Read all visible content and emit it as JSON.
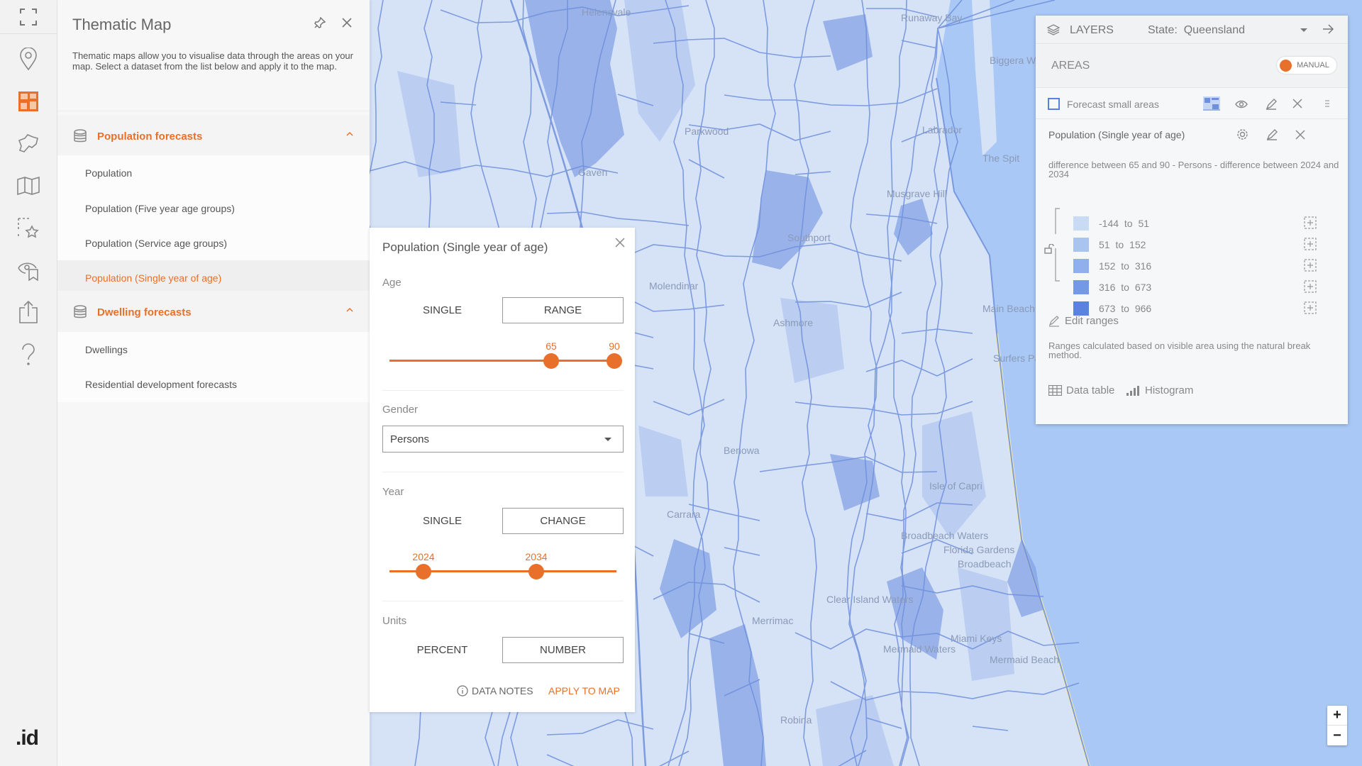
{
  "colors": {
    "accent": "#e8702a",
    "sea": "#a9c8f5",
    "land": "#d6e2f6",
    "boundary": "#6e8fdc"
  },
  "rail": {
    "icons": [
      "fullscreen-icon",
      "location-pin-icon",
      "thematic-map-icon",
      "area-shape-icon",
      "basemap-icon",
      "favourite-area-icon",
      "view-bookmark-icon",
      "share-export-icon",
      "help-icon"
    ],
    "logo": ".id"
  },
  "panel": {
    "title": "Thematic Map",
    "description": "Thematic maps allow you to visualise data through the areas on your map. Select a dataset from the list below and apply it to the map.",
    "sections": [
      {
        "label": "Population forecasts",
        "items": [
          "Population",
          "Population (Five year age groups)",
          "Population (Service age groups)",
          "Population (Single year of age)"
        ],
        "active": "Population (Single year of age)"
      },
      {
        "label": "Dwelling forecasts",
        "items": [
          "Dwellings",
          "Residential development forecasts"
        ]
      }
    ]
  },
  "popup": {
    "title": "Population (Single year of age)",
    "age": {
      "label": "Age",
      "options": [
        "SINGLE",
        "RANGE"
      ],
      "selected": "RANGE",
      "min": 65,
      "max": 90,
      "range_min": 0,
      "range_max": 90
    },
    "gender": {
      "label": "Gender",
      "value": "Persons"
    },
    "year": {
      "label": "Year",
      "options": [
        "SINGLE",
        "CHANGE"
      ],
      "selected": "CHANGE",
      "from": "2024",
      "to": "2034",
      "values": [
        "2024",
        "2034"
      ]
    },
    "units": {
      "label": "Units",
      "options": [
        "PERCENT",
        "NUMBER"
      ],
      "selected": "NUMBER"
    },
    "data_notes": "DATA NOTES",
    "apply": "APPLY TO MAP"
  },
  "layers": {
    "title": "LAYERS",
    "state_label": "State:",
    "state_value": "Queensland",
    "areas_label": "AREAS",
    "toggle_label": "MANUAL",
    "layer_name": "Forecast small areas",
    "dataset": "Population (Single year of age)",
    "description": "difference between 65 and 90 - Persons - difference between 2024 and 2034",
    "legend": [
      {
        "label": "-144 to 51",
        "color": "#c9daf5"
      },
      {
        "label": "51 to 152",
        "color": "#aac4f0"
      },
      {
        "label": "152 to 316",
        "color": "#8fb0ec"
      },
      {
        "label": "316 to 673",
        "color": "#7399e6"
      },
      {
        "label": "673 to 966",
        "color": "#5a83df"
      }
    ],
    "edit_ranges": "Edit ranges",
    "note": "Ranges calculated based on visible area using the natural break method.",
    "data_table": "Data table",
    "histogram": "Histogram"
  },
  "map": {
    "labels": [
      "Helensvale",
      "Runaway Bay",
      "Biggera Waters",
      "Labrador",
      "The Spit",
      "Parkwood",
      "Gaven",
      "Musgrave Hill",
      "Southport",
      "Molendinar",
      "Main Beach",
      "Surfers Paradise",
      "Ashmore",
      "Benowa",
      "Carrara",
      "Isle of Capri",
      "Broadbeach Waters",
      "Florida Gardens",
      "Broadbeach",
      "Clear Island Waters",
      "Merrimac",
      "Mermaid Waters",
      "Miami Keys",
      "Mermaid Beach",
      "Robina"
    ],
    "zoom_in": "+",
    "zoom_out": "−"
  }
}
